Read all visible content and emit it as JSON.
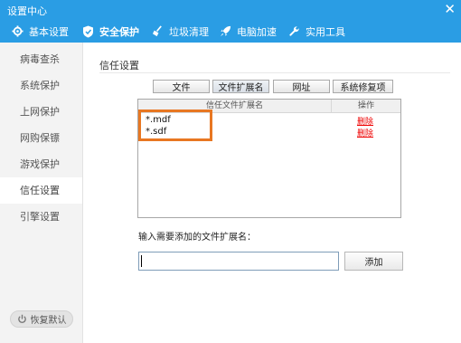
{
  "window": {
    "title": "设置中心",
    "close_label": "✕"
  },
  "tabs": [
    {
      "label": "基本设置",
      "icon": "gear-icon",
      "active": false
    },
    {
      "label": "安全保护",
      "icon": "shield-icon",
      "active": true
    },
    {
      "label": "垃圾清理",
      "icon": "broom-icon",
      "active": false
    },
    {
      "label": "电脑加速",
      "icon": "rocket-icon",
      "active": false
    },
    {
      "label": "实用工具",
      "icon": "wrench-icon",
      "active": false
    }
  ],
  "sidebar": {
    "items": [
      {
        "label": "病毒查杀",
        "active": false
      },
      {
        "label": "系统保护",
        "active": false
      },
      {
        "label": "上网保护",
        "active": false
      },
      {
        "label": "网购保镖",
        "active": false
      },
      {
        "label": "游戏保护",
        "active": false
      },
      {
        "label": "信任设置",
        "active": true
      },
      {
        "label": "引擎设置",
        "active": false
      }
    ],
    "restore_label": "恢复默认"
  },
  "main": {
    "section_title": "信任设置",
    "subtabs": [
      {
        "label": "文件",
        "active": false
      },
      {
        "label": "文件扩展名",
        "active": true
      },
      {
        "label": "网址",
        "active": false
      },
      {
        "label": "系统修复项",
        "active": false
      }
    ],
    "list": {
      "headers": [
        "信任文件扩展名",
        "操作"
      ],
      "rows": [
        {
          "name": "*.mdf",
          "action": "删除"
        },
        {
          "name": "*.sdf",
          "action": "删除"
        }
      ]
    },
    "input_label": "输入需要添加的文件扩展名：",
    "input_value": "",
    "input_placeholder": "",
    "add_label": "添加"
  },
  "colors": {
    "title_bar": "#2a9de4",
    "highlight": "#e87722",
    "delete_link": "#e00000"
  }
}
